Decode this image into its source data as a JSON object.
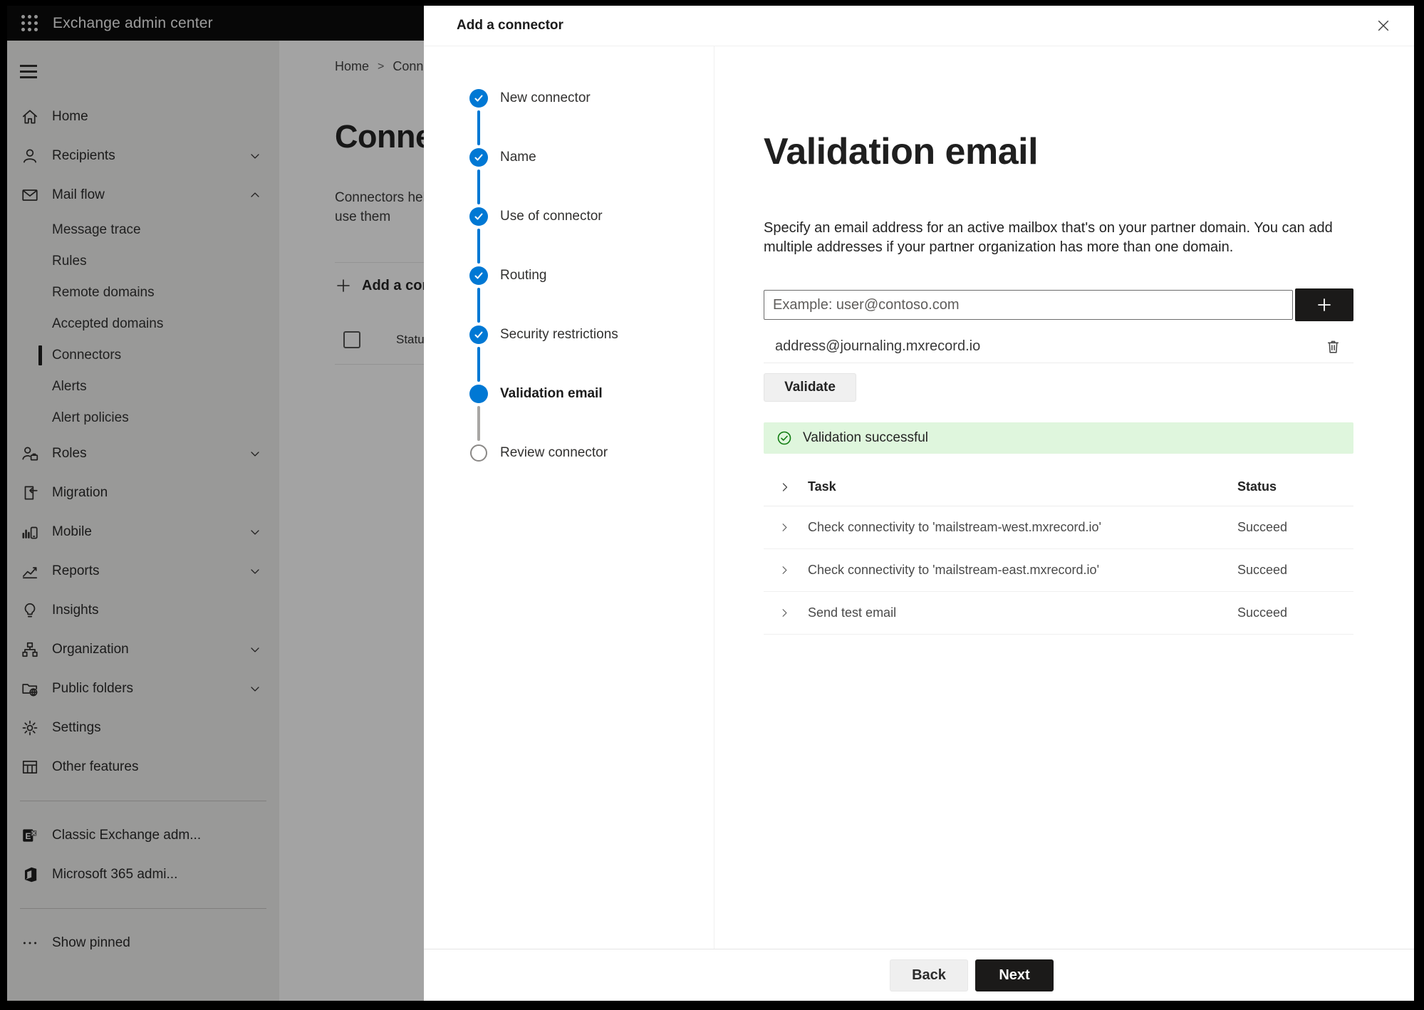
{
  "topbar": {
    "app_title": "Exchange admin center"
  },
  "sidebar": {
    "items": [
      {
        "label": "Home"
      },
      {
        "label": "Recipients"
      },
      {
        "label": "Mail flow"
      },
      {
        "label": "Message trace"
      },
      {
        "label": "Rules"
      },
      {
        "label": "Remote domains"
      },
      {
        "label": "Accepted domains"
      },
      {
        "label": "Connectors"
      },
      {
        "label": "Alerts"
      },
      {
        "label": "Alert policies"
      },
      {
        "label": "Roles"
      },
      {
        "label": "Migration"
      },
      {
        "label": "Mobile"
      },
      {
        "label": "Reports"
      },
      {
        "label": "Insights"
      },
      {
        "label": "Organization"
      },
      {
        "label": "Public folders"
      },
      {
        "label": "Settings"
      },
      {
        "label": "Other features"
      }
    ],
    "footer_items": [
      {
        "label": "Classic Exchange adm..."
      },
      {
        "label": "Microsoft 365 admi..."
      }
    ],
    "show_pinned": "Show pinned"
  },
  "page": {
    "breadcrumb_home": "Home",
    "breadcrumb_sep": ">",
    "breadcrumb_current": "Conne",
    "title": "Connect",
    "desc_lines": "Connectors help route mail, we recommend that you only need to use them",
    "add_button": "Add a conn",
    "status_header": "Status"
  },
  "panel": {
    "title": "Add a connector",
    "steps": [
      {
        "label": "New connector",
        "state": "done"
      },
      {
        "label": "Name",
        "state": "done"
      },
      {
        "label": "Use of connector",
        "state": "done"
      },
      {
        "label": "Routing",
        "state": "done"
      },
      {
        "label": "Security restrictions",
        "state": "done"
      },
      {
        "label": "Validation email",
        "state": "active"
      },
      {
        "label": "Review connector",
        "state": "upcoming"
      }
    ],
    "content": {
      "heading": "Validation email",
      "description": "Specify an email address for an active mailbox that's on your partner domain. You can add multiple addresses if your partner organization has more than one domain.",
      "email_input": {
        "placeholder": "Example: user@contoso.com",
        "value": ""
      },
      "added_address": "address@journaling.mxrecord.io",
      "validate_button": "Validate",
      "banner": {
        "text": "Validation successful"
      },
      "results_table": {
        "columns": {
          "task": "Task",
          "status": "Status"
        },
        "rows": [
          {
            "task": "Check connectivity to 'mailstream-west.mxrecord.io'",
            "status": "Succeed"
          },
          {
            "task": "Check connectivity to 'mailstream-east.mxrecord.io'",
            "status": "Succeed"
          },
          {
            "task": "Send test email",
            "status": "Succeed"
          }
        ]
      }
    },
    "footer": {
      "back": "Back",
      "next": "Next"
    }
  },
  "colors": {
    "accent_blue": "#0078d4",
    "success_bg": "#dff6dd",
    "success_green": "#107c10",
    "primary_button": "#1b1a19",
    "topbar_bg": "#0c0c0c",
    "sidebar_bg": "#f0efee"
  }
}
